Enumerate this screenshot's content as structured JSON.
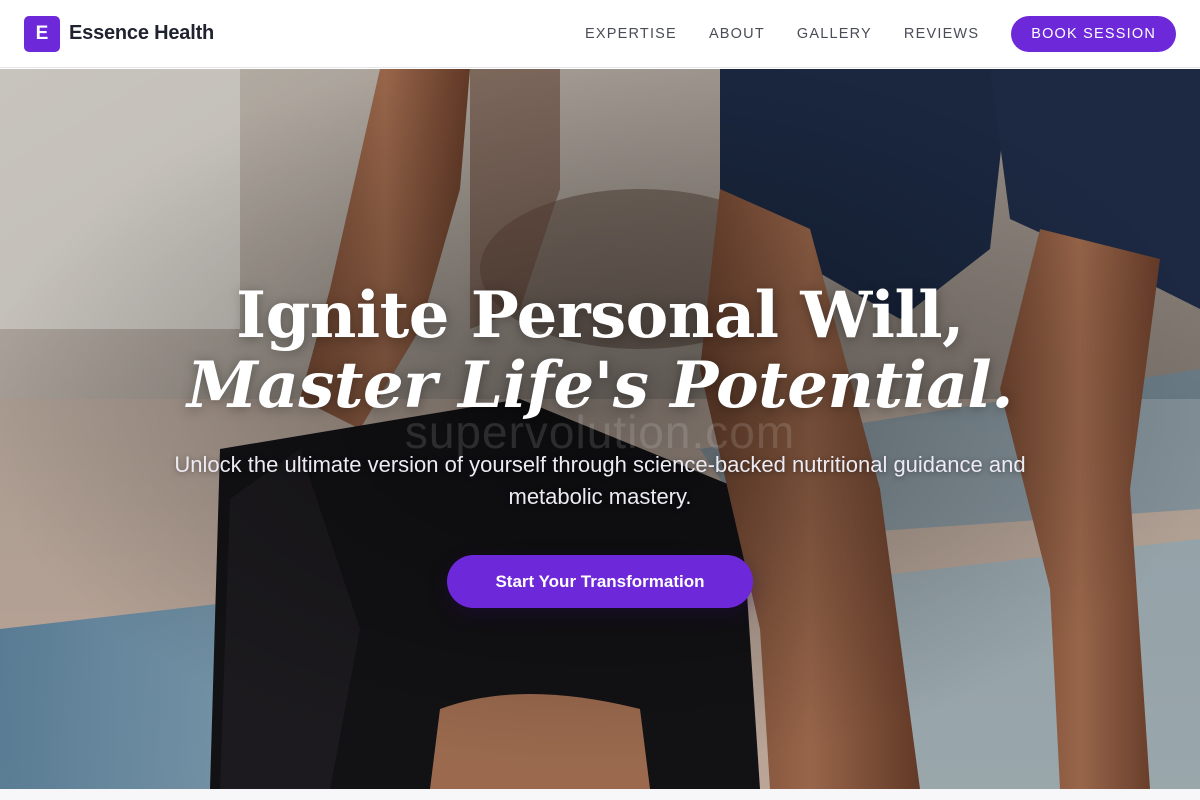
{
  "header": {
    "logo_letter": "E",
    "brand_name": "Essence Health",
    "nav": [
      {
        "label": "EXPERTISE"
      },
      {
        "label": "ABOUT"
      },
      {
        "label": "GALLERY"
      },
      {
        "label": "REVIEWS"
      }
    ],
    "cta_label": "BOOK SESSION"
  },
  "hero": {
    "headline_line1": "Ignite Personal Will,",
    "headline_line2": "Master Life's Potential.",
    "watermark": "supervolution.com",
    "subtitle": "Unlock the ultimate version of yourself through science-backed nutritional guidance and metabolic mastery.",
    "cta_label": "Start Your Transformation"
  },
  "colors": {
    "accent": "#6d28d9",
    "header_bg": "#ffffff",
    "text_dark": "#1f2330",
    "nav_text": "#4a4d57"
  }
}
